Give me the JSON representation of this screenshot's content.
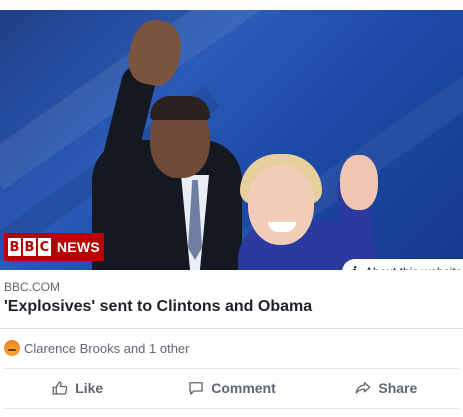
{
  "post": {
    "image_alt": "Barack Obama and Hillary Clinton waving",
    "badge": {
      "letters": [
        "B",
        "B",
        "C"
      ],
      "news": "NEWS"
    },
    "about": {
      "icon": "info-icon",
      "label": "About this website"
    },
    "link": {
      "domain": "BBC.COM",
      "headline": "'Explosives' sent to Clintons and Obama"
    },
    "reactions": {
      "icon": "angry-reaction-icon",
      "text": "Clarence Brooks and 1 other"
    },
    "actions": {
      "like": "Like",
      "comment": "Comment",
      "share": "Share"
    }
  },
  "colors": {
    "bbc_red": "#b80000",
    "muted_text": "#606770"
  }
}
